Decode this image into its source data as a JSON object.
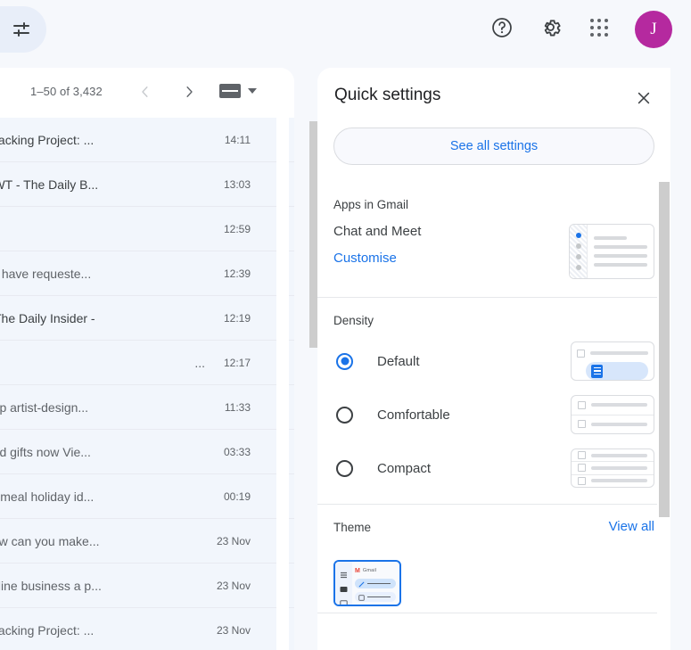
{
  "topbar": {
    "tune_icon": "tune-icon",
    "help_icon": "help-icon",
    "settings_icon": "gear-icon",
    "apps_icon": "apps-grid-icon",
    "avatar_initial": "J",
    "avatar_color": "#b5299f"
  },
  "mail": {
    "page_count": "1–50 of 3,432",
    "prev_label": "‹",
    "next_label": "›",
    "keyboard_icon": "keyboard-icon",
    "caret_icon": "chevron-down-icon",
    "rows": [
      {
        "subject": "on Tracking Project: ...",
        "time": "14:11",
        "dark": true
      },
      {
        "subject": "nd JWT - The Daily B...",
        "time": "13:03",
        "dark": true
      },
      {
        "subject": "",
        "time": "12:59",
        "dark": false
      },
      {
        "subject": "- You have requeste...",
        "time": "12:39",
        "dark": false
      },
      {
        "subject": "y? - The Daily Insider -",
        "time": "12:19",
        "dark": true
      },
      {
        "subject": "...",
        "time": "12:17",
        "dark": false
      },
      {
        "subject": "- Shop artist-design...",
        "time": "11:33",
        "dark": false
      },
      {
        "subject": "signed gifts now Vie...",
        "time": "03:33",
        "dark": false
      },
      {
        "subject": "inute meal holiday id...",
        "time": "00:19",
        "dark": false
      },
      {
        "subject": "v: How can you make...",
        "time": "23 Nov",
        "dark": false
      },
      {
        "subject": "ur online business a p...",
        "time": "23 Nov",
        "dark": false
      },
      {
        "subject": "on Tracking Project: ...",
        "time": "23 Nov",
        "dark": false
      }
    ]
  },
  "quick_settings": {
    "title": "Quick settings",
    "close_icon": "close-icon",
    "see_all_label": "See all settings",
    "apps": {
      "section_label": "Apps in Gmail",
      "item_label": "Chat and Meet",
      "customise_label": "Customise",
      "preview_icon": "chat-meet-preview"
    },
    "density": {
      "section_label": "Density",
      "options": [
        {
          "label": "Default",
          "selected": true
        },
        {
          "label": "Comfortable",
          "selected": false
        },
        {
          "label": "Compact",
          "selected": false
        }
      ]
    },
    "theme": {
      "section_label": "Theme",
      "view_all_label": "View all",
      "thumb_brand": "Gmail",
      "thumb_brand_mark": "M"
    },
    "accent_color": "#1a73e8"
  }
}
